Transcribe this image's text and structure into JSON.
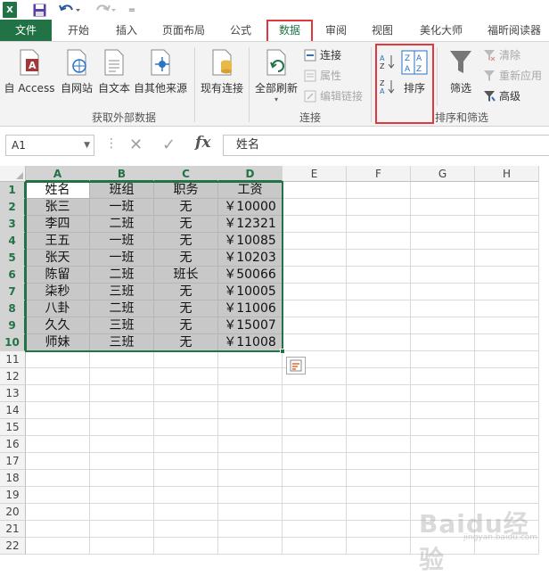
{
  "qat": {
    "logo_text": "X",
    "more_glyph": "="
  },
  "tabs": [
    {
      "id": "file",
      "label": "文件"
    },
    {
      "id": "home",
      "label": "开始"
    },
    {
      "id": "insert",
      "label": "插入"
    },
    {
      "id": "layout",
      "label": "页面布局"
    },
    {
      "id": "formula",
      "label": "公式"
    },
    {
      "id": "data",
      "label": "数据"
    },
    {
      "id": "review",
      "label": "审阅"
    },
    {
      "id": "view",
      "label": "视图"
    },
    {
      "id": "beautify",
      "label": "美化大师"
    },
    {
      "id": "foxit",
      "label": "福昕阅读器"
    }
  ],
  "ribbon": {
    "get_external": {
      "buttons": [
        "自 Access",
        "自网站",
        "自文本",
        "自其他来源"
      ],
      "existing": "现有连接",
      "label": "获取外部数据"
    },
    "connections": {
      "refresh_all": "全部刷新",
      "connect": "连接",
      "properties": "属性",
      "edit_links": "编辑链接",
      "label": "连接"
    },
    "sort_filter": {
      "sort": "排序",
      "filter": "筛选",
      "clear": "清除",
      "reapply": "重新应用",
      "advanced": "高级",
      "label": "排序和筛选",
      "az_top": "A",
      "az_bottom": "Z",
      "za_top": "Z",
      "za_bottom": "A"
    }
  },
  "formula_bar": {
    "name_box": "A1",
    "fx": "fx",
    "content": "姓名"
  },
  "columns": [
    "A",
    "B",
    "C",
    "D",
    "E",
    "F",
    "G",
    "H"
  ],
  "rows": [
    "1",
    "2",
    "3",
    "4",
    "5",
    "6",
    "7",
    "8",
    "9",
    "10",
    "11",
    "12",
    "13",
    "14",
    "15",
    "16",
    "17",
    "18",
    "19",
    "20",
    "21",
    "22"
  ],
  "table": [
    [
      "姓名",
      "班组",
      "职务",
      "工资"
    ],
    [
      "张三",
      "一班",
      "无",
      "￥10000"
    ],
    [
      "李四",
      "二班",
      "无",
      "￥12321"
    ],
    [
      "王五",
      "一班",
      "无",
      "￥10085"
    ],
    [
      "张天",
      "一班",
      "无",
      "￥10203"
    ],
    [
      "陈留",
      "二班",
      "班长",
      "￥50066"
    ],
    [
      "柒秒",
      "三班",
      "无",
      "￥10005"
    ],
    [
      "八卦",
      "二班",
      "无",
      "￥11006"
    ],
    [
      "久久",
      "三班",
      "无",
      "￥15007"
    ],
    [
      "师妹",
      "三班",
      "无",
      "￥11008"
    ]
  ],
  "colors": {
    "excel_green": "#217346",
    "highlight_red": "#e0383e",
    "selection_gray": "#c8c8c8"
  },
  "watermark": {
    "main": "Baidu经验",
    "sub": "jingyan.baidu.com"
  }
}
